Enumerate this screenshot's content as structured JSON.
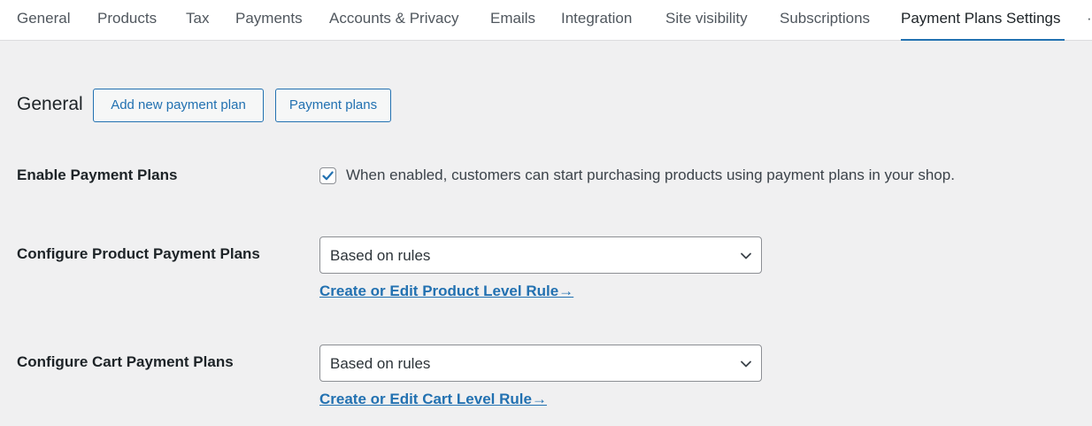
{
  "tabs": [
    {
      "label": "General"
    },
    {
      "label": "Products"
    },
    {
      "label": "Tax"
    },
    {
      "label": "Payments"
    },
    {
      "label": "Accounts & Privacy"
    },
    {
      "label": "Emails"
    },
    {
      "label": "Integration"
    },
    {
      "label": "Site visibility"
    },
    {
      "label": "Subscriptions"
    },
    {
      "label": "Payment Plans Settings"
    }
  ],
  "active_tab": "Payment Plans Settings",
  "section": {
    "title": "General",
    "add_button": "Add new payment plan",
    "list_button": "Payment plans"
  },
  "settings": {
    "enable": {
      "label": "Enable Payment Plans",
      "checked": true,
      "description": "When enabled, customers can start purchasing products using payment plans in your shop."
    },
    "product": {
      "label": "Configure Product Payment Plans",
      "selected": "Based on rules",
      "link": "Create or Edit Product Level Rule→"
    },
    "cart": {
      "label": "Configure Cart Payment Plans",
      "selected": "Based on rules",
      "link": "Create or Edit Cart Level Rule→"
    }
  },
  "colors": {
    "accent": "#2271b1",
    "background": "#f0f0f1",
    "text": "#1d2327"
  }
}
